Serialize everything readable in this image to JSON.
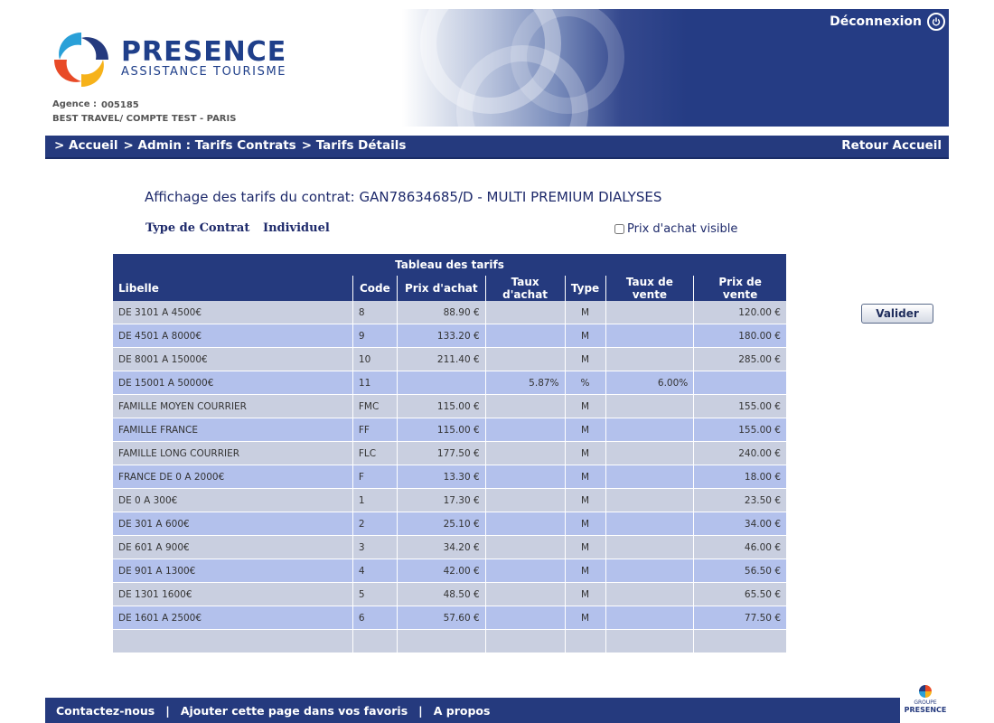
{
  "header": {
    "brand_name": "PRESENCE",
    "brand_sub": "ASSISTANCE TOURISME",
    "agency_label": "Agence :",
    "agency_code": "005185",
    "agency_name": "BEST TRAVEL/ COMPTE TEST - PARIS",
    "logout_label": "Déconnexion",
    "logout_icon": "power-icon"
  },
  "nav": {
    "breadcrumb": [
      "> Accueil",
      "> Admin : Tarifs Contrats",
      "> Tarifs Détails"
    ],
    "home_link": "Retour Accueil"
  },
  "main": {
    "title": "Affichage des tarifs du contrat: GAN78634685/D - MULTI PREMIUM DIALYSES",
    "contract_type_label": "Type de Contrat",
    "contract_type_value": "Individuel",
    "price_visible_label": "Prix d'achat visible",
    "price_visible_checked": false,
    "validate_label": "Valider"
  },
  "table": {
    "caption": "Tableau des tarifs",
    "columns": [
      "Libelle",
      "Code",
      "Prix d'achat",
      "Taux d'achat",
      "Type",
      "Taux de vente",
      "Prix de vente"
    ],
    "rows": [
      [
        "DE 3101 A 4500€",
        "8",
        "88.90 €",
        "",
        "M",
        "",
        "120.00 €"
      ],
      [
        "DE 4501 A 8000€",
        "9",
        "133.20 €",
        "",
        "M",
        "",
        "180.00 €"
      ],
      [
        "DE 8001 A 15000€",
        "10",
        "211.40 €",
        "",
        "M",
        "",
        "285.00 €"
      ],
      [
        "DE 15001 A 50000€",
        "11",
        "",
        "5.87%",
        "%",
        "6.00%",
        ""
      ],
      [
        "FAMILLE MOYEN COURRIER",
        "FMC",
        "115.00 €",
        "",
        "M",
        "",
        "155.00 €"
      ],
      [
        "FAMILLE FRANCE",
        "FF",
        "115.00 €",
        "",
        "M",
        "",
        "155.00 €"
      ],
      [
        "FAMILLE LONG COURRIER",
        "FLC",
        "177.50 €",
        "",
        "M",
        "",
        "240.00 €"
      ],
      [
        "FRANCE DE 0 A 2000€",
        "F",
        "13.30 €",
        "",
        "M",
        "",
        "18.00 €"
      ],
      [
        "DE 0 A 300€",
        "1",
        "17.30 €",
        "",
        "M",
        "",
        "23.50 €"
      ],
      [
        "DE 301 A 600€",
        "2",
        "25.10 €",
        "",
        "M",
        "",
        "34.00 €"
      ],
      [
        "DE 601 A 900€",
        "3",
        "34.20 €",
        "",
        "M",
        "",
        "46.00 €"
      ],
      [
        "DE 901 A 1300€",
        "4",
        "42.00 €",
        "",
        "M",
        "",
        "56.50 €"
      ],
      [
        "DE 1301 1600€",
        "5",
        "48.50 €",
        "",
        "M",
        "",
        "65.50 €"
      ],
      [
        "DE 1601 A 2500€",
        "6",
        "57.60 €",
        "",
        "M",
        "",
        "77.50 €"
      ],
      [
        "",
        "",
        "",
        "",
        "",
        "",
        ""
      ]
    ]
  },
  "footer": {
    "links": [
      "Contactez-nous",
      "Ajouter cette page dans vos favoris",
      "A propos"
    ],
    "separator": "|",
    "group_label": "GROUPE",
    "group_name": "PRESENCE"
  },
  "colors": {
    "navy": "#253a7e",
    "row_odd": "#c9cfe0",
    "row_even": "#b3c1ec"
  }
}
